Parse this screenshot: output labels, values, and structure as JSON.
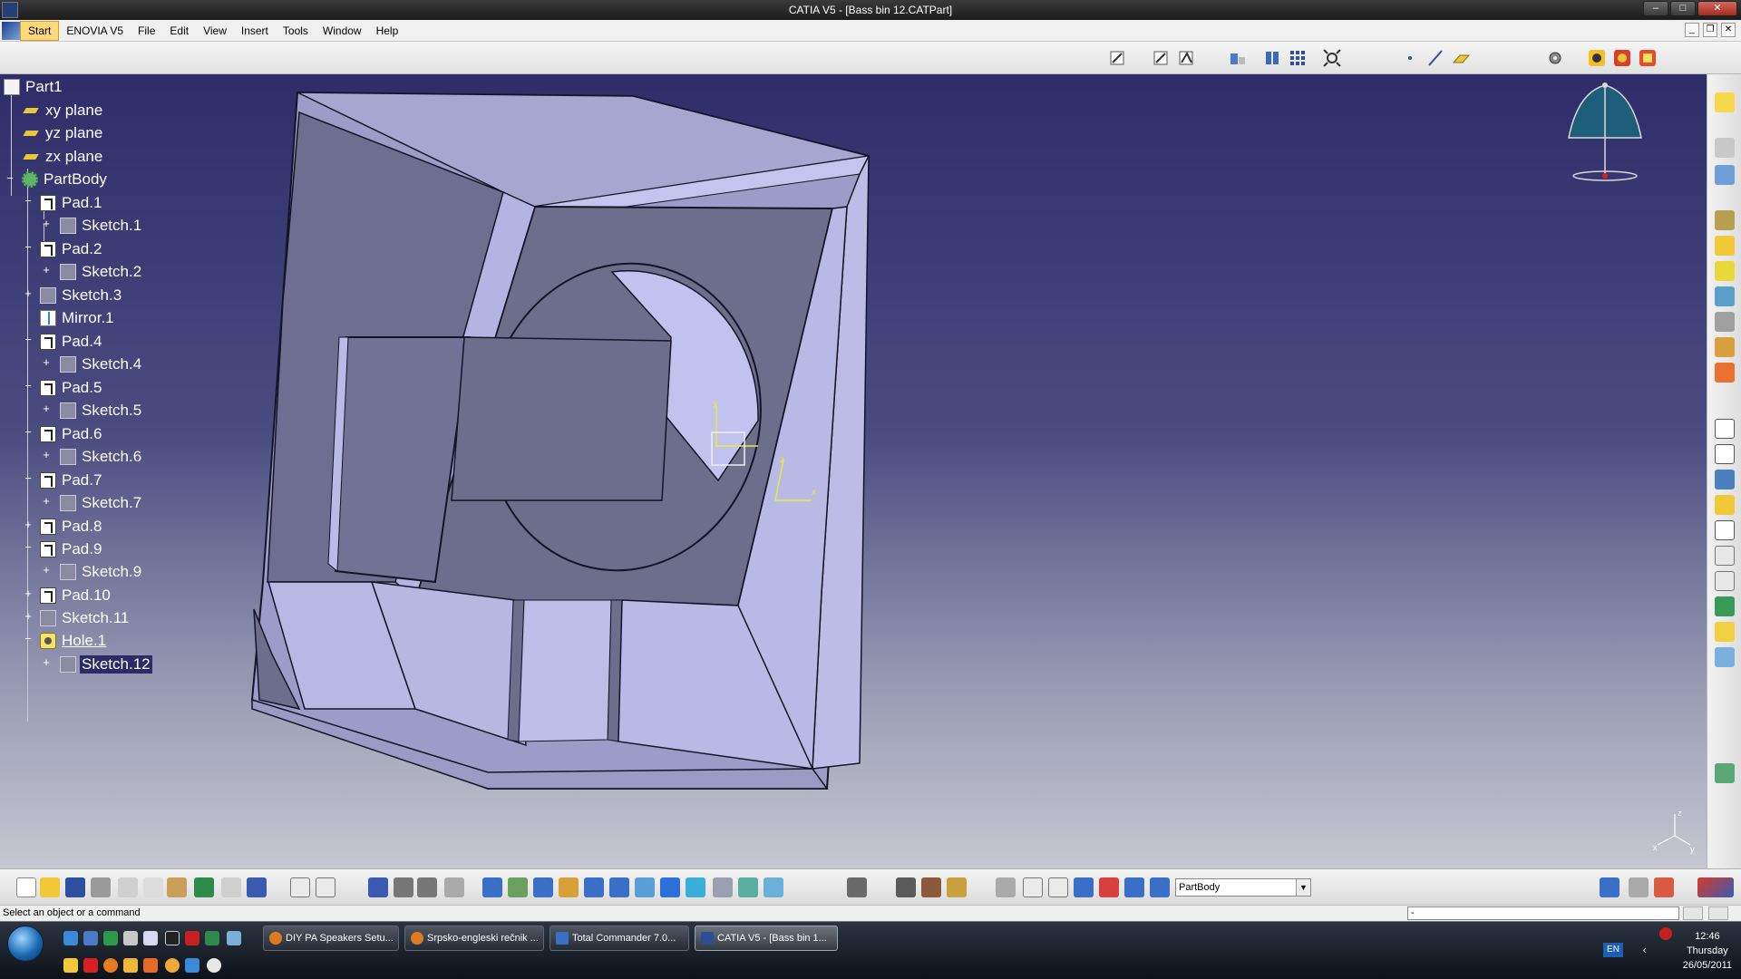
{
  "window": {
    "title": "CATIA V5 - [Bass bin 12.CATPart]"
  },
  "menu": {
    "items": [
      "Start",
      "ENOVIA V5",
      "File",
      "Edit",
      "View",
      "Insert",
      "Tools",
      "Window",
      "Help"
    ]
  },
  "tree": {
    "nodes": [
      {
        "label": "Part1"
      },
      {
        "label": "xy plane"
      },
      {
        "label": "yz plane"
      },
      {
        "label": "zx plane"
      },
      {
        "label": "PartBody"
      },
      {
        "label": "Pad.1"
      },
      {
        "label": "Sketch.1"
      },
      {
        "label": "Pad.2"
      },
      {
        "label": "Sketch.2"
      },
      {
        "label": "Sketch.3"
      },
      {
        "label": "Mirror.1"
      },
      {
        "label": "Pad.4"
      },
      {
        "label": "Sketch.4"
      },
      {
        "label": "Pad.5"
      },
      {
        "label": "Sketch.5"
      },
      {
        "label": "Pad.6"
      },
      {
        "label": "Sketch.6"
      },
      {
        "label": "Pad.7"
      },
      {
        "label": "Sketch.7"
      },
      {
        "label": "Pad.8"
      },
      {
        "label": "Pad.9"
      },
      {
        "label": "Sketch.9"
      },
      {
        "label": "Pad.10"
      },
      {
        "label": "Sketch.11"
      },
      {
        "label": "Hole.1"
      },
      {
        "label": "Sketch.12"
      }
    ]
  },
  "axis_labels": {
    "x": "x",
    "y": "y",
    "z": "z"
  },
  "toolbar": {
    "body_select": "PartBody"
  },
  "status": {
    "message": "Select an object or a command",
    "command_input": "-"
  },
  "taskbar": {
    "buttons": [
      {
        "label": "DIY PA Speakers Setu...",
        "icon_color": "#e07a22"
      },
      {
        "label": "Srpsko-engleski rečnik ...",
        "icon_color": "#e07a22"
      },
      {
        "label": "Total Commander 7.0...",
        "icon_color": "#3a6fc8"
      },
      {
        "label": "CATIA V5 - [Bass bin 1...",
        "icon_color": "#2d4e94"
      }
    ],
    "language": "EN",
    "time": "12:46",
    "day": "Thursday",
    "date": "26/05/2011"
  },
  "colors": {
    "viewport_top": "#2e2d6a",
    "viewport_bottom": "#c6c7d0",
    "model_face": "#b9b9e6"
  }
}
